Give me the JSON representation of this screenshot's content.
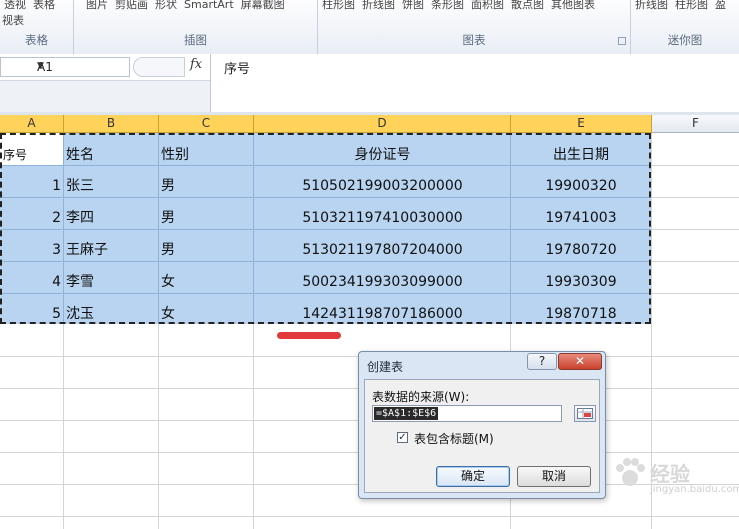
{
  "ribbon": {
    "groups": [
      {
        "label": "表格",
        "items": [
          "透视",
          "表格"
        ],
        "sub": "视表"
      },
      {
        "label": "插图",
        "items": [
          "图片",
          "剪贴画",
          "形状",
          "SmartArt",
          "屏幕截图"
        ]
      },
      {
        "label": "图表",
        "items": [
          "柱形图",
          "折线图",
          "饼图",
          "条形图",
          "面积图",
          "散点图",
          "其他图表"
        ]
      },
      {
        "label": "迷你图",
        "items": [
          "折线图",
          "柱形图",
          "盈"
        ]
      }
    ]
  },
  "formula_bar": {
    "name_box": "A1",
    "fx_label": "fx",
    "content": "序号"
  },
  "columns": [
    "A",
    "B",
    "C",
    "D",
    "E",
    "F"
  ],
  "table": {
    "headers": [
      "序号",
      "姓名",
      "性别",
      "身份证号",
      "出生日期"
    ],
    "rows": [
      [
        "1",
        "张三",
        "男",
        "510502199003200000",
        "19900320"
      ],
      [
        "2",
        "李四",
        "男",
        "510321197410030000",
        "19741003"
      ],
      [
        "3",
        "王麻子",
        "男",
        "513021197807204000",
        "19780720"
      ],
      [
        "4",
        "李雪",
        "女",
        "500234199303099000",
        "19930309"
      ],
      [
        "5",
        "沈玉",
        "女",
        "142431198707186000",
        "19870718"
      ]
    ]
  },
  "dialog": {
    "title": "创建表",
    "help_label": "?",
    "close_label": "✕",
    "source_label": "表数据的来源(W):",
    "range_value": "=$A$1:$E$6",
    "has_headers_label": "表包含标题(M)",
    "has_headers_checked": true,
    "ok_label": "确定",
    "cancel_label": "取消"
  },
  "watermark": {
    "text": "经验",
    "url": "jingyan.baidu.com"
  },
  "colors": {
    "selection": "#b8d4f0",
    "active_header": "#ffd35a",
    "annotation": "#e23a3a"
  }
}
